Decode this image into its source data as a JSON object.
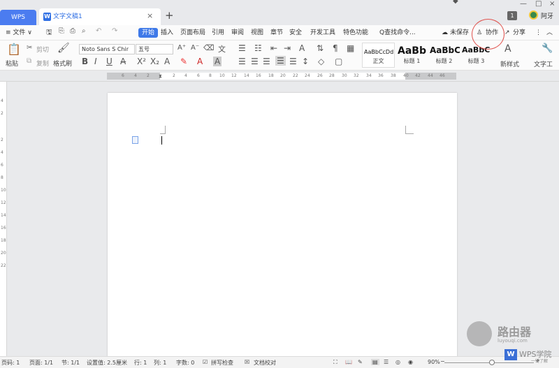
{
  "titlebar": {
    "wps_tab": "WPS",
    "doc_tab": "文字文稿1",
    "close": "×",
    "new_tab": "+",
    "badge": "1",
    "user": "阿牙",
    "win_min": "—",
    "win_max": "□",
    "win_close": "×"
  },
  "menubar": {
    "file": "≡ 文件 ∨",
    "start": "开始",
    "items": [
      "插入",
      "页面布局",
      "引用",
      "审阅",
      "视图",
      "章节",
      "安全",
      "开发工具",
      "特色功能"
    ],
    "search": "Q查找命令...",
    "unsaved": "未保存",
    "collab": "协作",
    "share": "分享"
  },
  "ribbon": {
    "paste": "粘贴",
    "cut": "剪切",
    "copy": "复制",
    "format_painter": "格式刷",
    "font_name": "Noto Sans S Chir",
    "font_size": "五号",
    "styles": [
      {
        "sample": "AaBbCcDd",
        "label": "正文"
      },
      {
        "sample": "AaBb",
        "label": "标题 1"
      },
      {
        "sample": "AaBbC",
        "label": "标题 2"
      },
      {
        "sample": "AaBbC",
        "label": "标题 3"
      }
    ],
    "new_style": "新样式",
    "text_tool": "文字工"
  },
  "ruler": {
    "left_ticks": [
      "6",
      "4",
      "2"
    ],
    "ticks": [
      "2",
      "4",
      "6",
      "8",
      "10",
      "12",
      "14",
      "16",
      "18",
      "20",
      "22",
      "24",
      "26",
      "28",
      "30",
      "32",
      "34",
      "36",
      "38",
      "40",
      "42",
      "44",
      "46"
    ],
    "vticks": [
      "4",
      "2",
      "2",
      "4",
      "6",
      "8",
      "10",
      "12",
      "14",
      "16",
      "18",
      "20",
      "22"
    ]
  },
  "statusbar": {
    "page_code": "页码: 1",
    "page": "页面: 1/1",
    "section": "节: 1/1",
    "setting": "设置值: 2.5厘米",
    "row": "行: 1",
    "col": "列: 1",
    "words": "字数: 0",
    "spellcheck": "拼写检查",
    "proofread": "文档校对",
    "zoom": "90%"
  },
  "watermark": {
    "brand": "路由器",
    "site": "luyouqi.com",
    "wps_brand": "WPS学院",
    "wps_sub": "一键了解"
  }
}
